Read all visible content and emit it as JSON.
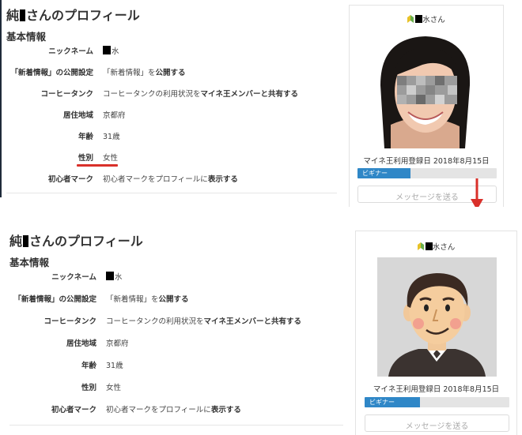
{
  "profile": {
    "title_prefix": "純",
    "title_suffix": "さんのプロフィール",
    "section_title": "基本情報",
    "rows": [
      {
        "label": "ニックネーム",
        "value": "水"
      },
      {
        "label": "「新着情報」の公開設定",
        "value_pre": "「新着情報」を",
        "value_bold": "公開する"
      },
      {
        "label": "コーヒータンク",
        "value_pre": "コーヒータンクの利用状況を",
        "value_bold": "マイネ王メンバーと共有する"
      },
      {
        "label": "居住地域",
        "value": "京都府"
      },
      {
        "label": "年齢",
        "value": "31歳"
      },
      {
        "label": "性別",
        "value": "女性"
      },
      {
        "label": "初心者マーク",
        "value_pre": "初心者マークをプロフィールに",
        "value_bold": "表示する"
      }
    ]
  },
  "card": {
    "name_suffix": "水さん",
    "registered": "マイネ王利用登録日 2018年8月15日",
    "rank_label": "ビギナー",
    "rank_progress": 0.38,
    "message_button": "メッセージを送る"
  },
  "colors": {
    "accent_blue": "#2f87c7",
    "highlight_red": "#d9302a",
    "leaf_green": "#6ab04c"
  }
}
